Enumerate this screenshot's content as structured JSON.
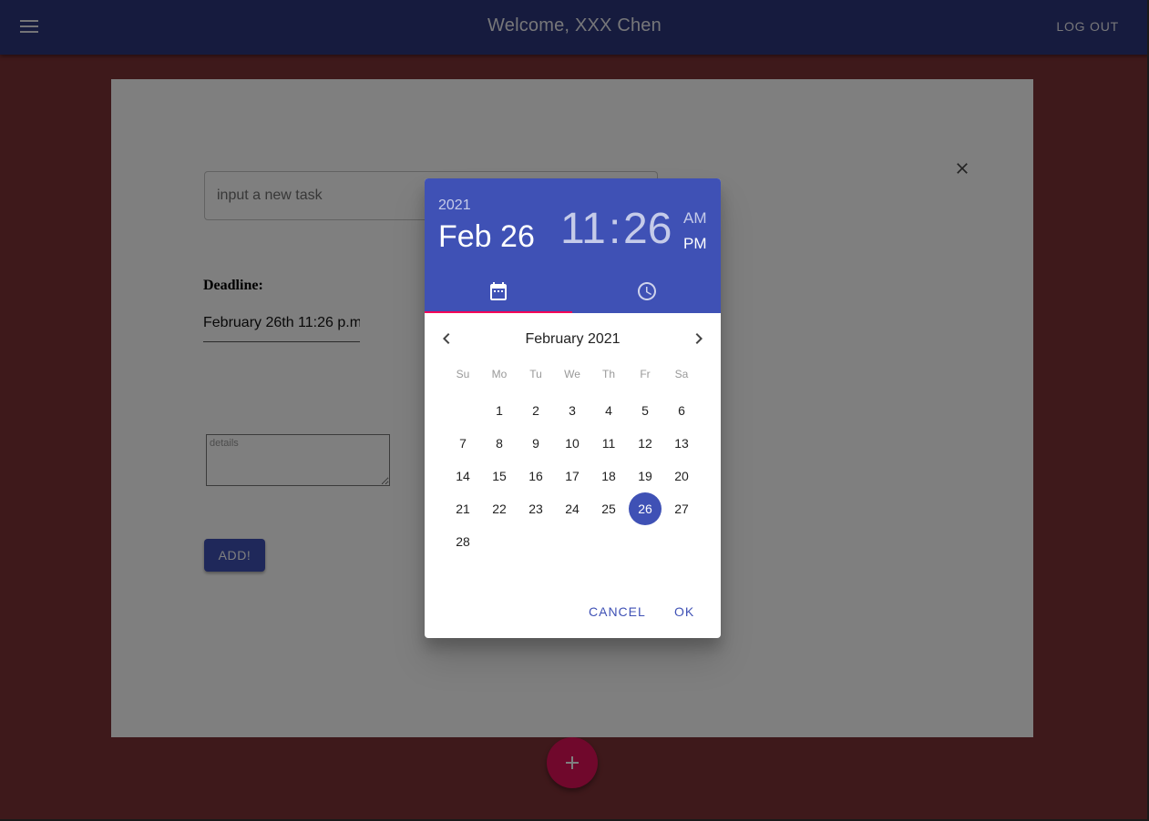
{
  "appbar": {
    "title": "Welcome, XXX Chen",
    "logout_label": "LOG OUT"
  },
  "form": {
    "task_placeholder": "input a new task",
    "deadline_label": "Deadline:",
    "deadline_value": "February 26th 11:26 p.m.",
    "details_placeholder": "details",
    "add_label": "ADD!"
  },
  "fab": {
    "icon": "plus-icon"
  },
  "picker": {
    "year": "2021",
    "date": "Feb 26",
    "hour": "11",
    "colon": ":",
    "minute": "26",
    "am": "AM",
    "pm": "PM",
    "month_title": "February 2021",
    "weekdays": [
      "Su",
      "Mo",
      "Tu",
      "We",
      "Th",
      "Fr",
      "Sa"
    ],
    "weeks": [
      [
        "",
        "1",
        "2",
        "3",
        "4",
        "5",
        "6"
      ],
      [
        "7",
        "8",
        "9",
        "10",
        "11",
        "12",
        "13"
      ],
      [
        "14",
        "15",
        "16",
        "17",
        "18",
        "19",
        "20"
      ],
      [
        "21",
        "22",
        "23",
        "24",
        "25",
        "26",
        "27"
      ],
      [
        "28",
        "",
        "",
        "",
        "",
        "",
        ""
      ]
    ],
    "selected_day": "26",
    "cancel_label": "CANCEL",
    "ok_label": "OK"
  },
  "colors": {
    "primary": "#3f51b5",
    "accent": "#f50057",
    "background": "#7d3236",
    "appbar": "#2c377c"
  }
}
